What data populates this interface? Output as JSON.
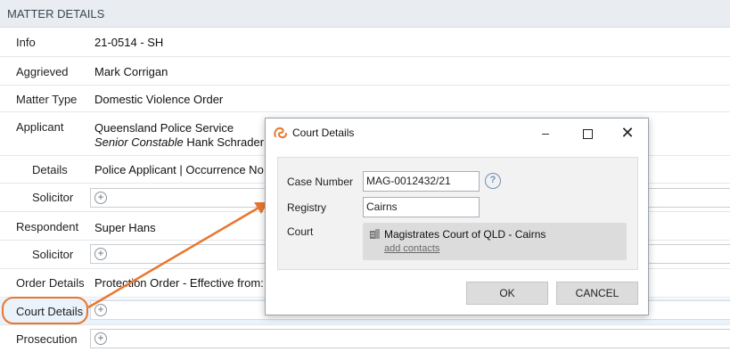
{
  "header": {
    "title": "MATTER DETAILS"
  },
  "rows": {
    "info": {
      "label": "Info",
      "value": "21-0514 - SH"
    },
    "aggrieved": {
      "label": "Aggrieved",
      "value": "Mark Corrigan"
    },
    "matter_type": {
      "label": "Matter Type",
      "value": "Domestic Violence Order"
    },
    "applicant": {
      "label": "Applicant",
      "value": "Queensland Police Service",
      "officer_role": "Senior Constable",
      "officer_name": "Hank Schrader"
    },
    "details": {
      "label": "Details",
      "value": "Police Applicant | Occurrence No:"
    },
    "solicitor1": {
      "label": "Solicitor",
      "add": "+"
    },
    "respondent": {
      "label": "Respondent",
      "value": "Super Hans"
    },
    "solicitor2": {
      "label": "Solicitor",
      "add": "+"
    },
    "order_details": {
      "label": "Order Details",
      "value": "Protection Order - Effective from:"
    },
    "court_details": {
      "label": "Court Details",
      "add": "+"
    },
    "prosecution": {
      "label": "Prosecution",
      "add": "+"
    }
  },
  "dialog": {
    "title": "Court Details",
    "minimize": "–",
    "close": "✕",
    "case_number_label": "Case Number",
    "case_number_value": "MAG-0012432/21",
    "help": "?",
    "registry_label": "Registry",
    "registry_value": "Cairns",
    "court_label": "Court",
    "court_name": "Magistrates Court of QLD - Cairns",
    "add_contacts": "add contacts",
    "ok": "OK",
    "cancel": "CANCEL"
  },
  "colors": {
    "accent": "#e8772e",
    "header_bg": "#e9edf1",
    "highlight_row": "#eaf2fb"
  }
}
